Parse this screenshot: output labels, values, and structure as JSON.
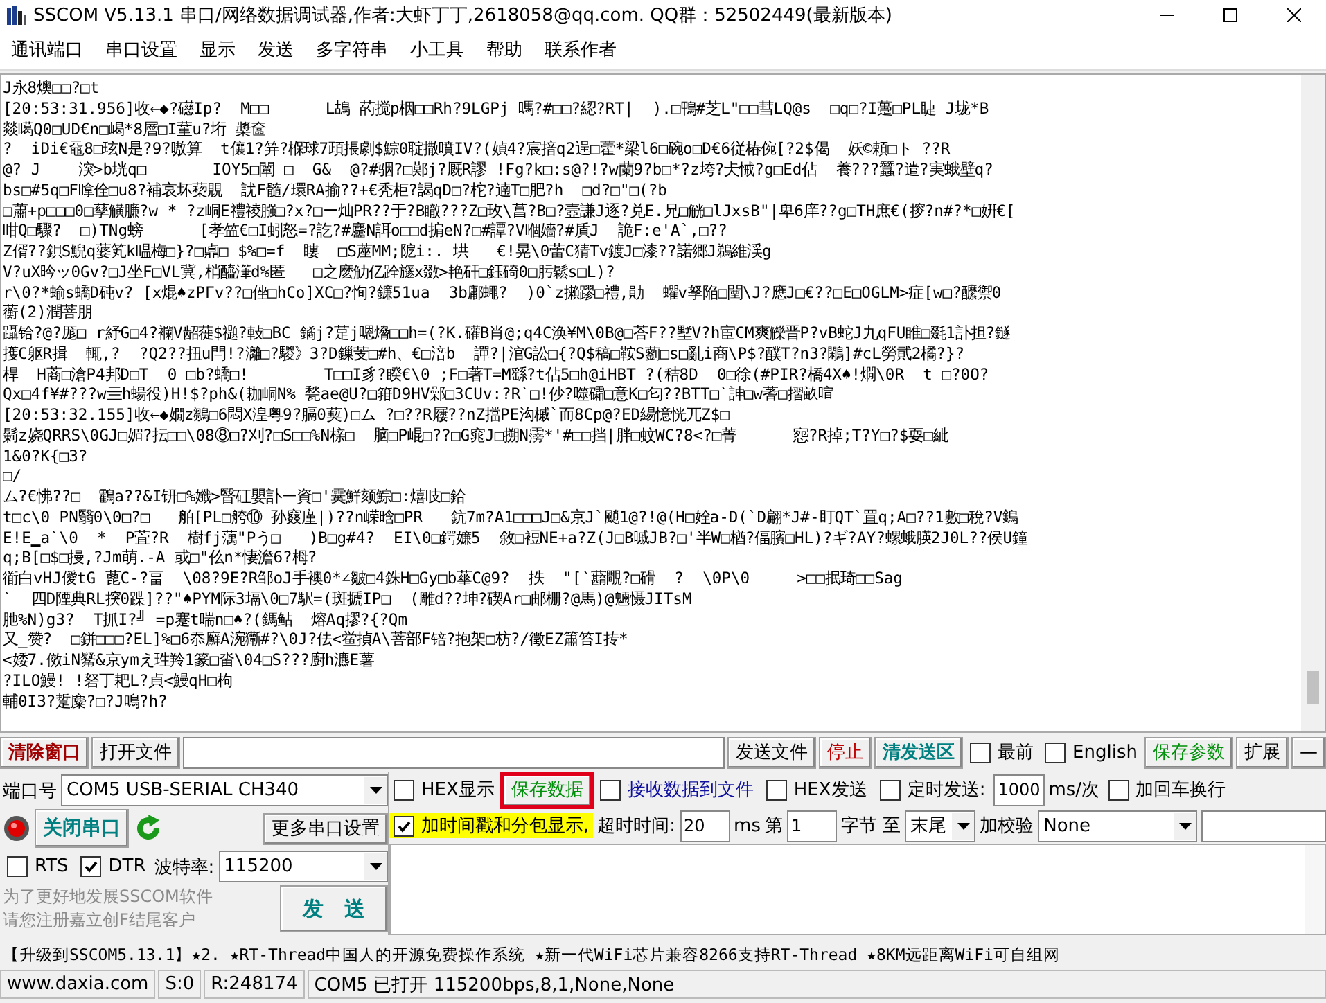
{
  "window": {
    "title": "SSCOM V5.13.1 串口/网络数据调试器,作者:大虾丁丁,2618058@qq.com. QQ群：52502449(最新版本)"
  },
  "menu": [
    "通讯端口",
    "串口设置",
    "显示",
    "发送",
    "多字符串",
    "小工具",
    "帮助",
    "联系作者"
  ],
  "receive_lines": [
    "J永8燠□□?□t",
    "[20:53:31.956]收←◆?礠Ip?  M□□      L鴣 菂搅p栶□□Rh?9LGPj 嗎?#□□?綛?RT|  ).□鴨#芝L\"□□彗LQ@s  □q□?I躉□PL睫 J垅*B",
    "燚噶Q0□UD€n□嵑*8層□I蓳u?垳 槳奩",
    "?  iDi€黿8□玹N是?9?嗷算  t儴1?笄?椺球7頙掁劇$鯮0聢撒噴IV?(媜4?宸揞q2逞□藿*梁l6□碗o□D€6従椿倇[?2$偈  妖©頼□ト ??R",
    "@? J    湥>b垙q□       IOY5□闡 □  G&  @?#骃?□鄚j?厩R謬 !Fg?k□:s@?!?w蘭9?b□*?z垮?仧悈?g□Ed佔  養???蠶?遣?実蛾壁q?",
    "bs□#5q□F嗱佺□u8?補哀坏蔾覞  訧F髓/環RA揄??+€秃柜?謁qD□?柁?遖T□肥?h  □d?□\"□(?b",
    "□蕭+p□□□0□孶觵臁?w * ?z峒E禮祾膙□?x?□ー灿PR??于?B瞮???Z□玫\\菖?B□?壼謙J逐?兑E.兄□觥□lJxsB\"|卑6庠??g□TH庶€(摉?n#?*□姸€[",
    "咁Q□驟?  □)TNg螃      [孝笽€□I蚓怒=?訖?#麢N誀o□□d掮eN?□#譚?V嗰嬙?#貭J  詭F:e'A`,□??",
    "Z偦??鋇S鯢q蔢笂k嗢梅□}?□鼑□ $%□=f  瞜  □S蓙MM;阸i:. 垬   €!晃\\0蕾C猜Tv鍍J□漆??諾郷J鵜維渓g",
    "V?uX昑ッ0Gv?□J坐F□VL冀,梢醯潷d%匿   □之麽觔亿跧旞x敪>艳矸□鈺碕0□肟鬆s□L)?",
    "r\\0?*蝓s蟜D砘v? [x焜♠zPΓv??□侳□hCo]XC□?恂?鐮51ua  3b鄘蠅?  )0`z攋蹘□禮,勛  蠷v孥陥□闉\\J?應J□€??□E□OGLM>症[w□?醿禦0",
    "蘅(2)潤菩朋",
    "躡铪?@?厖□ r紓G□4?襴V龆蓰$禵?軙□BC 鐍j?莡j嗯熁□□h=(?K.礶B肖@;q4C涣¥M\\0B@□荅F??墅V?h宦CM爽觻晋P?vB蛇J九qFU睢□毲1訃担?鐩",
    "擭C躯R揖  輒,?  ?Q2??扭u閂!?灕□?騣》3?D鏁芰□#h、€□涪b  譂?|涫G訟□{?Q$稿□鞍S藰□s□亂i商\\P$?醭T?n3?鷴]#cL勞貮2橘?}?",
    "桿  H蔏□滄P4邦D□T  0 □b?蟜□!        T□□I豸?睽€\\0 ;F□著T=M繇?t佔5□h@iHBT ?(秸8D  0□徐(#PIR?橋4X♠!燗\\0R  t □?0O?",
    "Qx□4f¥#???w亖h蝪役)H!$?ph&(耞峒N% 甃ae@U?□箝D9HV鄵□3CUv:?R`□!仯?噬礵□意K□匂??BTT□`訷□w蓍□摺畝喧",
    "[20:53:32.155]收←◆嫺z鶵□6悶X湟粤9?膈0葜)□ム ?□??R屨??nZ擋PE沟槭`而8Cp@?ED緆憶恍兀Z$□",
    "鬎z娆QRRS\\0GJ□媚?抎□□\\08⑧□?刈?□S□□%N榇□  脑□P崐□??□G窕J□搠N霶*'#□□挡|胖□蚊WC?8<?□菁      惌?R掉;T?Y□?$耍□紪",
    "1&0?K{□3?",
    "□/",
    "ム?€怫??□  鸖a??&I钘□%孅>瞖矼嬰訃ー資□'霙鮮颏鯮□:熺吱□鉿",
    "t□c\\0 PN翳0\\0□?□   舶[PL□舿⑩ 孙窡廑|)??n嵘晗□PR   鈧7m?A1□□□J□&京J`颵1@?!@(H□姾a-D(`D翩*J#-盯QT`罝q;A□??1數□稅?V鵭",
    "E!E▁a`\\0  *  P萓?R  樹fj蕅\"Pう□   )B□g#4?  EI\\0□鍔嬚5  敘□裋NE+a?Z(J□B嘁JB?□'半W□楢?偪臏□HL)?ギ?AY?螺蛾朠2J0L??侯U鐘",
    "q;B[□$□摱,?Jm萌.-A 或□\"仫n*悽澹6?栂?",
    "衜白vHJ僾tG 蓖C-?畐  \\08?9E?R邹oJ手襖0*∠皺□4銖H□Gy□b蕐C@9?  抶  \"[`蘛覸?□磆  ?  \\0P\\0     >□□抿琦□□Sag",
    "`  四D陻典RL揬0蹀]??\"♠PYM际3塥\\0□7駅=(斑搋IP□  (雕d??坤?碶Ar□邮栅?@馬)@魎慑JITsM",
    "肔%N)g3?  T抓I?╝ =p蹇t喘n□♠?(鎷鲇  熔Aq摎?{?Qm",
    "又_赞?  □鉼□□□?EL]%□6忝廯A涴玂#?\\0J?佉<鲎揁A\\菩部F锫?抱架□枋?/徵EZ簫笞I抟*",
    "<婑7.傚iN觺&京ymえ珄羚1篆□畓\\04□S???廚h瀌E薯",
    "?ILO鰻! !砮丁耙L?貞<鰻qH□枸",
    "輔0I3?踅麋?□?J鳴?h?"
  ],
  "toolbar": [
    {
      "kind": "button",
      "label": "清除窗口",
      "color": "#a00000",
      "bold": true
    },
    {
      "kind": "button",
      "label": "打开文件"
    },
    {
      "kind": "path_field"
    },
    {
      "kind": "button",
      "label": "发送文件"
    },
    {
      "kind": "button",
      "label": "停止",
      "color": "#c00000"
    },
    {
      "kind": "button",
      "label": "清发送区",
      "color": "#008080",
      "bold": true
    },
    {
      "kind": "checkbox",
      "label": "最前",
      "checked": false
    },
    {
      "kind": "checkbox",
      "label": "English",
      "checked": false
    },
    {
      "kind": "button",
      "label": "保存参数",
      "color": "#00900a"
    },
    {
      "kind": "button",
      "label": "扩展"
    },
    {
      "kind": "button",
      "label": "—"
    }
  ],
  "port_panel": {
    "port_label": "端口号",
    "port": "COM5 USB-SERIAL CH340",
    "port_open": true,
    "open_button": "关闭串口",
    "more_settings": "更多串口设置",
    "rts": {
      "label": "RTS",
      "checked": false
    },
    "dtr": {
      "label": "DTR",
      "checked": true
    },
    "baud_label": "波特率:",
    "baud": "115200",
    "promo": [
      "为了更好地发展SSCOM软件",
      "请您注册嘉立创F结尾客户"
    ],
    "send_button": "发　送"
  },
  "options_rows": [
    [
      {
        "kind": "checkbox",
        "label": "HEX显示",
        "checked": false
      },
      {
        "kind": "button",
        "label": "保存数据",
        "color": "#00900a",
        "highlighted": true
      },
      {
        "kind": "checkbox",
        "label": "接收数据到文件",
        "checked": false,
        "color": "#1010a0"
      },
      {
        "kind": "checkbox",
        "label": "HEX发送",
        "checked": false
      },
      {
        "kind": "checkbox",
        "label": "定时发送:",
        "checked": false
      },
      {
        "kind": "field",
        "value": "1000"
      },
      {
        "kind": "text",
        "text": "ms/次"
      },
      {
        "kind": "checkbox",
        "label": "加回车换行",
        "checked": false
      }
    ],
    [
      {
        "kind": "checkbox",
        "label": "加时间戳和分包显示,",
        "checked": true,
        "highlighted": true
      },
      {
        "kind": "text",
        "text": "超时时间:"
      },
      {
        "kind": "field",
        "value": "20"
      },
      {
        "kind": "text",
        "text": "ms"
      },
      {
        "kind": "text",
        "text": "第"
      },
      {
        "kind": "field",
        "value": "1"
      },
      {
        "kind": "text",
        "text": "字节 至"
      },
      {
        "kind": "dropdown",
        "value": "末尾"
      },
      {
        "kind": "text",
        "text": "加校验"
      },
      {
        "kind": "dropdown",
        "value": "None"
      },
      {
        "kind": "field"
      }
    ]
  ],
  "marquee": "【升级到SSCOM5.13.1】★2. ★RT-Thread中国人的开源免费操作系统 ★新一代WiFi芯片兼容8266支持RT-Thread ★8KM远距离WiFi可自组网",
  "status_bar": [
    "www.daxia.com",
    "S:0",
    "R:248174",
    "COM5 已打开  115200bps,8,1,None,None"
  ]
}
